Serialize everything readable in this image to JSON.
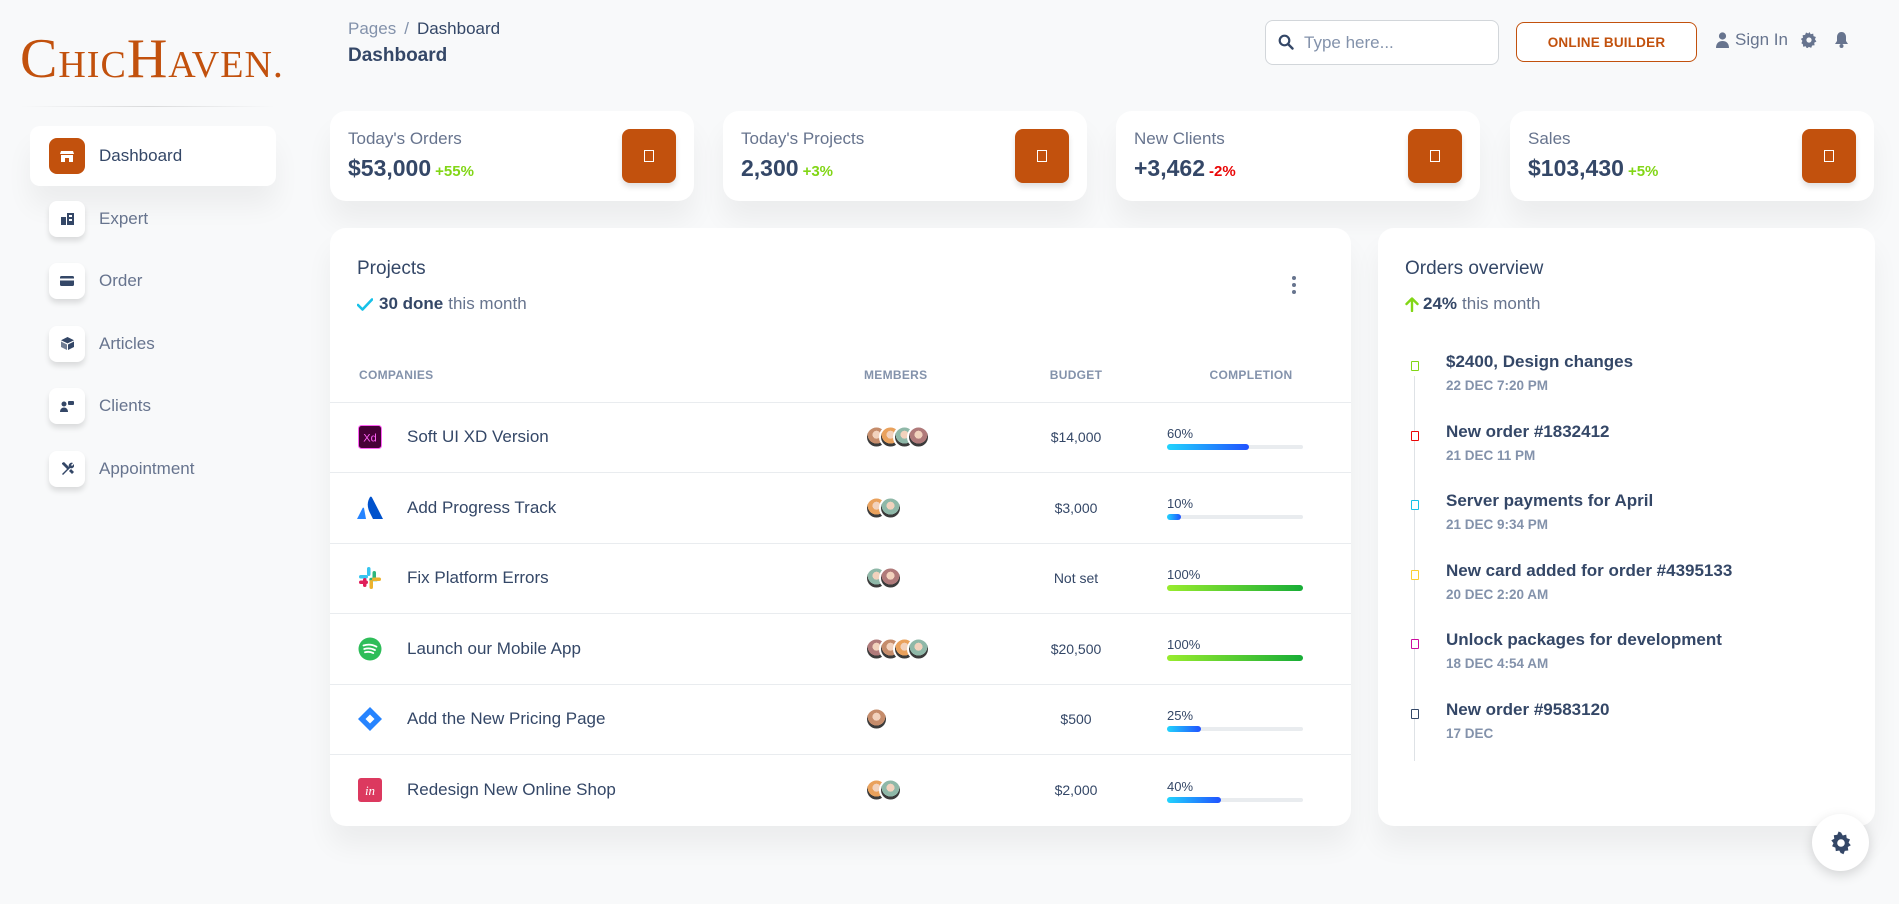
{
  "brand": {
    "part1_big": "C",
    "part1_small": "HIC",
    "part2_big": "H",
    "part2_small": "AVEN",
    "dot": ".",
    "color": "#c2510d"
  },
  "sidebar": {
    "items": [
      {
        "label": "Dashboard",
        "icon": "shop-icon",
        "active": true
      },
      {
        "label": "Expert",
        "icon": "office-icon",
        "active": false
      },
      {
        "label": "Order",
        "icon": "credit-card-icon",
        "active": false
      },
      {
        "label": "Articles",
        "icon": "box-3d-icon",
        "active": false
      },
      {
        "label": "Clients",
        "icon": "customer-support-icon",
        "active": false
      },
      {
        "label": "Appointment",
        "icon": "settings-tools-icon",
        "active": false
      }
    ]
  },
  "header": {
    "breadcrumb": {
      "root": "Pages",
      "separator": "/",
      "current": "Dashboard"
    },
    "title": "Dashboard",
    "search_placeholder": "Type here...",
    "builder_label": "ONLINE BUILDER",
    "signin_label": "Sign In"
  },
  "stats": [
    {
      "label": "Today's Orders",
      "value": "$53,000",
      "change": "+55%",
      "trend": "up"
    },
    {
      "label": "Today's Projects",
      "value": "2,300",
      "change": "+3%",
      "trend": "up"
    },
    {
      "label": "New Clients",
      "value": "+3,462",
      "change": "-2%",
      "trend": "down"
    },
    {
      "label": "Sales",
      "value": "$103,430",
      "change": "+5%",
      "trend": "up"
    }
  ],
  "projects": {
    "title": "Projects",
    "done_count": "30 done",
    "done_suffix": "this month",
    "columns": [
      "Companies",
      "Members",
      "Budget",
      "Completion"
    ],
    "rows": [
      {
        "company": "Soft UI XD Version",
        "logo": "xd-logo",
        "members": 4,
        "budget": "$14,000",
        "completion": "60%",
        "progress": 0.6,
        "bar": "info"
      },
      {
        "company": "Add Progress Track",
        "logo": "atlassian-logo",
        "members": 2,
        "budget": "$3,000",
        "completion": "10%",
        "progress": 0.1,
        "bar": "info"
      },
      {
        "company": "Fix Platform Errors",
        "logo": "slack-logo",
        "members": 2,
        "budget": "Not set",
        "completion": "100%",
        "progress": 1.0,
        "bar": "success"
      },
      {
        "company": "Launch our Mobile App",
        "logo": "spotify-logo",
        "members": 4,
        "budget": "$20,500",
        "completion": "100%",
        "progress": 1.0,
        "bar": "success"
      },
      {
        "company": "Add the New Pricing Page",
        "logo": "jira-logo",
        "members": 1,
        "budget": "$500",
        "completion": "25%",
        "progress": 0.25,
        "bar": "info"
      },
      {
        "company": "Redesign New Online Shop",
        "logo": "invision-logo",
        "members": 2,
        "budget": "$2,000",
        "completion": "40%",
        "progress": 0.4,
        "bar": "info"
      }
    ]
  },
  "orders": {
    "title": "Orders overview",
    "percent": "24%",
    "suffix": "this month",
    "items": [
      {
        "title": "$2400, Design changes",
        "date": "22 DEC 7:20 PM",
        "color": "#82d616"
      },
      {
        "title": "New order #1832412",
        "date": "21 DEC 11 PM",
        "color": "#ea0606"
      },
      {
        "title": "Server payments for April",
        "date": "21 DEC 9:34 PM",
        "color": "#17c1e8"
      },
      {
        "title": "New card added for order #4395133",
        "date": "20 DEC 2:20 AM",
        "color": "#fbcf33"
      },
      {
        "title": "Unlock packages for development",
        "date": "18 DEC 4:54 AM",
        "color": "#cb0c9f"
      },
      {
        "title": "New order #9583120",
        "date": "17 DEC",
        "color": "#344767"
      }
    ]
  }
}
